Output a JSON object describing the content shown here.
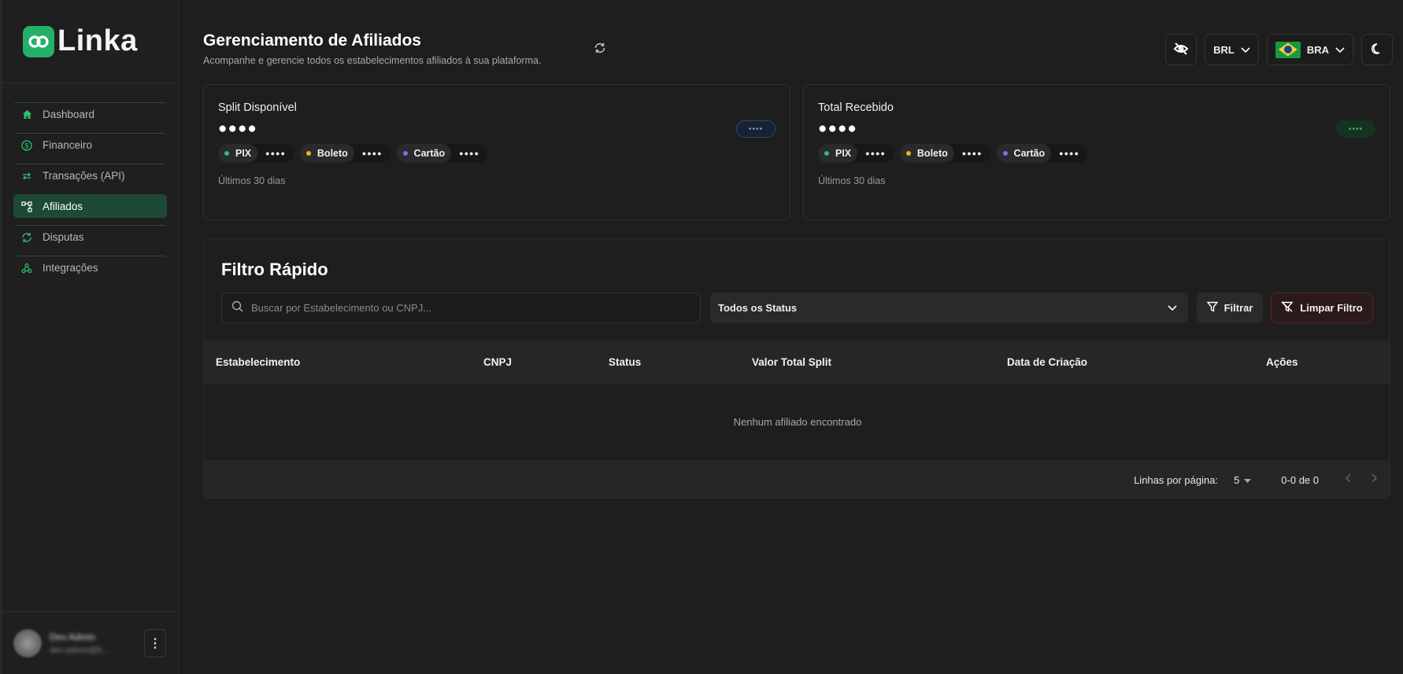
{
  "app": {
    "name": "Linka",
    "brand_color": "#25b06a"
  },
  "sidebar": {
    "items": [
      {
        "label": "Dashboard",
        "icon": "home-icon",
        "active": false
      },
      {
        "label": "Financeiro",
        "icon": "dollar-circle-icon",
        "active": false
      },
      {
        "label": "Transações (API)",
        "icon": "arrows-exchange-icon",
        "active": false
      },
      {
        "label": "Afiliados",
        "icon": "network-icon",
        "active": true
      },
      {
        "label": "Disputas",
        "icon": "refresh-icon",
        "active": false
      },
      {
        "label": "Integrações",
        "icon": "webhook-icon",
        "active": false
      }
    ],
    "user": {
      "name": "Dev Admin",
      "email": "dev.admin@li..."
    }
  },
  "header": {
    "title": "Gerenciamento de Afiliados",
    "subtitle": "Acompanhe e gerencie todos os estabelecimentos afiliados à sua plataforma.",
    "currency": "BRL",
    "country": "BRA"
  },
  "cards": [
    {
      "title": "Split Disponível",
      "value": "●●●●",
      "badge": "••••",
      "methods": [
        {
          "label": "PIX",
          "value": "●●●●",
          "color": "#2fbf73"
        },
        {
          "label": "Boleto",
          "value": "●●●●",
          "color": "#e6b325"
        },
        {
          "label": "Cartão",
          "value": "●●●●",
          "color": "#7c6ef0"
        }
      ],
      "period": "Últimos 30 dias"
    },
    {
      "title": "Total Recebido",
      "value": "●●●●",
      "badge": "••••",
      "methods": [
        {
          "label": "PIX",
          "value": "●●●●",
          "color": "#2fbf73"
        },
        {
          "label": "Boleto",
          "value": "●●●●",
          "color": "#e6b325"
        },
        {
          "label": "Cartão",
          "value": "●●●●",
          "color": "#7c6ef0"
        }
      ],
      "period": "Últimos 30 dias"
    }
  ],
  "filter": {
    "title": "Filtro Rápido",
    "search_placeholder": "Buscar por Estabelecimento ou CNPJ...",
    "status_selected": "Todos os Status",
    "filter_label": "Filtrar",
    "clear_label": "Limpar Filtro"
  },
  "table": {
    "columns": [
      "Estabelecimento",
      "CNPJ",
      "Status",
      "Valor Total Split",
      "Data de Criação",
      "Ações"
    ],
    "empty_message": "Nenhum afiliado encontrado",
    "rows_per_page_label": "Linhas por página:",
    "rows_per_page": "5",
    "range": "0-0 de 0"
  }
}
